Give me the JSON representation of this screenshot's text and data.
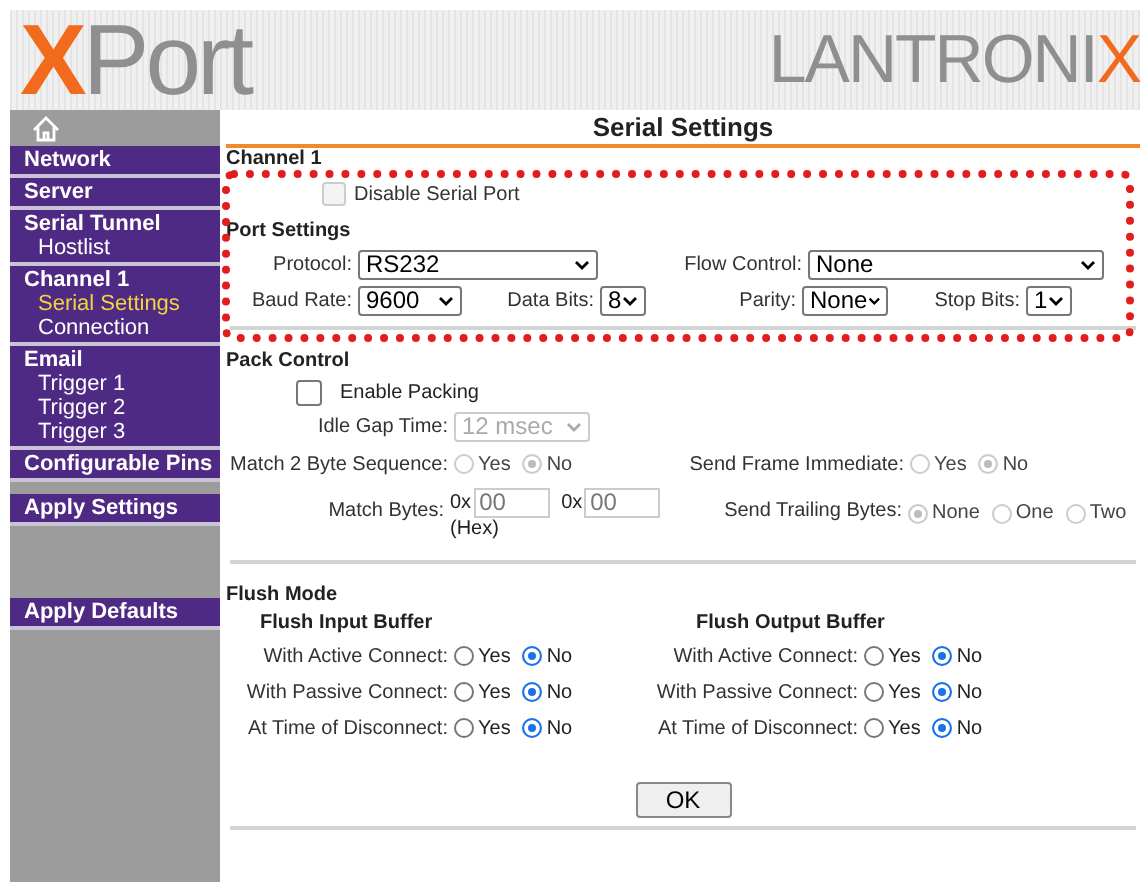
{
  "header": {
    "left_logo": {
      "accent": "X",
      "rest": "Port"
    },
    "right_logo": {
      "rest": "LANTRONI",
      "accent": "X"
    }
  },
  "page_title": "Serial Settings",
  "sidebar": {
    "items": [
      {
        "label": "Network",
        "kind": "section",
        "selected": false
      },
      {
        "label": "Server",
        "kind": "section",
        "selected": false
      },
      {
        "label": "Serial Tunnel",
        "kind": "section",
        "selected": false,
        "children": [
          {
            "label": "Hostlist",
            "selected": false
          }
        ]
      },
      {
        "label": "Channel 1",
        "kind": "section",
        "selected": false,
        "children": [
          {
            "label": "Serial Settings",
            "selected": true
          },
          {
            "label": "Connection",
            "selected": false
          }
        ]
      },
      {
        "label": "Email",
        "kind": "section",
        "selected": false,
        "children": [
          {
            "label": "Trigger 1",
            "selected": false
          },
          {
            "label": "Trigger 2",
            "selected": false
          },
          {
            "label": "Trigger 3",
            "selected": false
          }
        ]
      },
      {
        "label": "Configurable Pins",
        "kind": "section",
        "selected": false
      },
      {
        "label": "Apply Settings",
        "kind": "action",
        "selected": false
      },
      {
        "label": "Apply Defaults",
        "kind": "action",
        "selected": false
      }
    ]
  },
  "channel_title": "Channel 1",
  "disable_serial_port": {
    "label": "Disable Serial Port",
    "checked": false,
    "disabled": true
  },
  "port_settings": {
    "title": "Port Settings",
    "protocol": {
      "label": "Protocol:",
      "value": "RS232"
    },
    "flow_control": {
      "label": "Flow Control:",
      "value": "None"
    },
    "baud_rate": {
      "label": "Baud Rate:",
      "value": "9600"
    },
    "data_bits": {
      "label": "Data Bits:",
      "value": "8"
    },
    "parity": {
      "label": "Parity:",
      "value": "None"
    },
    "stop_bits": {
      "label": "Stop Bits:",
      "value": "1"
    }
  },
  "pack_control": {
    "title": "Pack Control",
    "enable_packing": {
      "label": "Enable Packing",
      "checked": false
    },
    "idle_gap_time": {
      "label": "Idle Gap Time:",
      "value": "12 msec",
      "disabled": true
    },
    "match_2_byte_sequence": {
      "label": "Match 2 Byte Sequence:",
      "disabled": true,
      "options": [
        {
          "label": "Yes",
          "selected": false
        },
        {
          "label": "No",
          "selected": true
        }
      ]
    },
    "send_frame_immediate": {
      "label": "Send Frame Immediate:",
      "disabled": true,
      "options": [
        {
          "label": "Yes",
          "selected": false
        },
        {
          "label": "No",
          "selected": true
        }
      ]
    },
    "match_bytes": {
      "label": "Match Bytes:",
      "disabled": true,
      "note": "(Hex)",
      "inputs": [
        {
          "prefix": "0x",
          "value": "00"
        },
        {
          "prefix": "0x",
          "value": "00"
        }
      ]
    },
    "send_trailing_bytes": {
      "label": "Send Trailing Bytes:",
      "disabled": true,
      "options": [
        {
          "label": "None",
          "selected": true
        },
        {
          "label": "One",
          "selected": false
        },
        {
          "label": "Two",
          "selected": false
        }
      ]
    }
  },
  "flush_mode": {
    "title": "Flush Mode",
    "groups": [
      {
        "title": "Flush Input Buffer",
        "rows": [
          {
            "label": "With Active Connect:",
            "options": [
              {
                "label": "Yes",
                "selected": false
              },
              {
                "label": "No",
                "selected": true
              }
            ]
          },
          {
            "label": "With Passive Connect:",
            "options": [
              {
                "label": "Yes",
                "selected": false
              },
              {
                "label": "No",
                "selected": true
              }
            ]
          },
          {
            "label": "At Time of Disconnect:",
            "options": [
              {
                "label": "Yes",
                "selected": false
              },
              {
                "label": "No",
                "selected": true
              }
            ]
          }
        ]
      },
      {
        "title": "Flush Output Buffer",
        "rows": [
          {
            "label": "With Active Connect:",
            "options": [
              {
                "label": "Yes",
                "selected": false
              },
              {
                "label": "No",
                "selected": true
              }
            ]
          },
          {
            "label": "With Passive Connect:",
            "options": [
              {
                "label": "Yes",
                "selected": false
              },
              {
                "label": "No",
                "selected": true
              }
            ]
          },
          {
            "label": "At Time of Disconnect:",
            "options": [
              {
                "label": "Yes",
                "selected": false
              },
              {
                "label": "No",
                "selected": true
              }
            ]
          }
        ]
      }
    ]
  },
  "ok_button": "OK",
  "annotations": [
    {
      "kind": "dotted-frame"
    }
  ]
}
